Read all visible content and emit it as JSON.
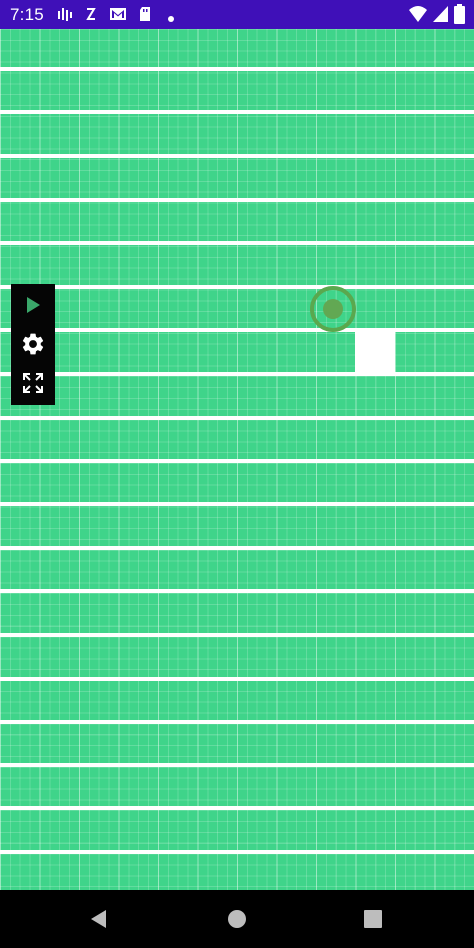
{
  "status_bar": {
    "time": "7:15",
    "background": "#3f10b8",
    "left_icons": [
      "signal-tester-icon",
      "sync-icon",
      "gmail-icon",
      "sd-card-icon",
      "notification-dot-icon"
    ],
    "right_icons": [
      "wifi-icon",
      "cellular-signal-icon",
      "battery-icon"
    ]
  },
  "game": {
    "board_color": "#3fd48a",
    "line_color": "#ffffff",
    "player_color": "#5aa84e",
    "tile_color": "#ffffff"
  },
  "toolbar": {
    "background": "#050505",
    "buttons": [
      {
        "name": "play",
        "icon": "play-icon",
        "color": "#3aa86a"
      },
      {
        "name": "settings",
        "icon": "gear-icon",
        "color": "#ffffff"
      },
      {
        "name": "fullscreen",
        "icon": "fullscreen-icon",
        "color": "#ffffff"
      }
    ]
  },
  "nav_bar": {
    "buttons": [
      "back-icon",
      "home-icon",
      "recents-icon"
    ]
  }
}
